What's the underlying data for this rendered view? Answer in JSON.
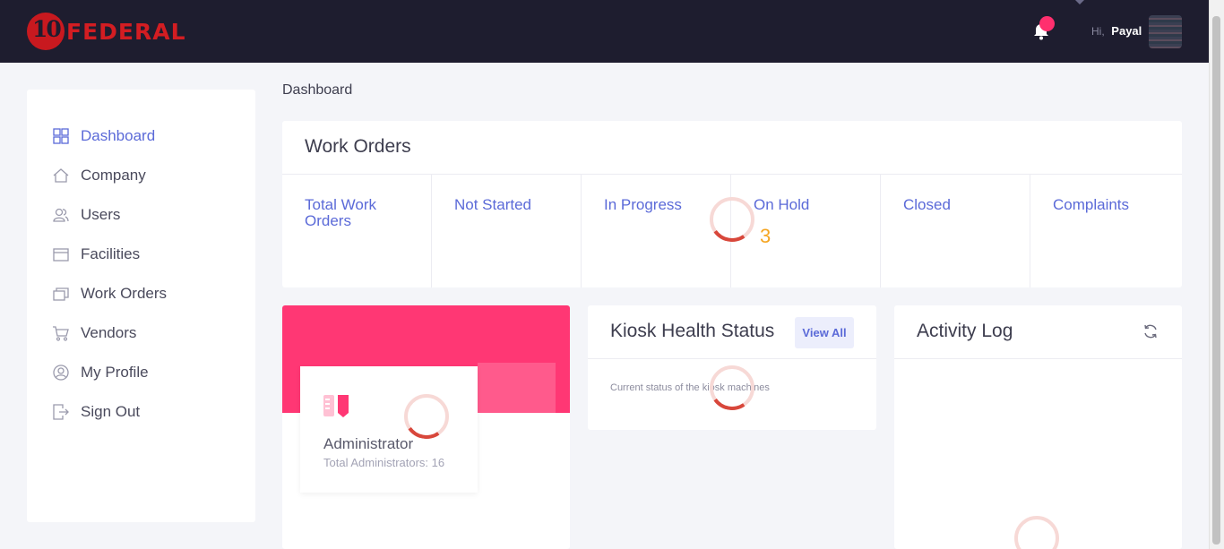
{
  "header": {
    "logo_number": "10",
    "logo_text": "FEDERAL",
    "greeting": "Hi,",
    "user_name": "Payal"
  },
  "sidebar": {
    "items": [
      {
        "label": "Dashboard",
        "icon": "dashboard-icon",
        "active": true
      },
      {
        "label": "Company",
        "icon": "home-icon",
        "active": false
      },
      {
        "label": "Users",
        "icon": "users-icon",
        "active": false
      },
      {
        "label": "Facilities",
        "icon": "facilities-icon",
        "active": false
      },
      {
        "label": "Work Orders",
        "icon": "work-orders-icon",
        "active": false
      },
      {
        "label": "Vendors",
        "icon": "cart-icon",
        "active": false
      },
      {
        "label": "My Profile",
        "icon": "profile-icon",
        "active": false
      },
      {
        "label": "Sign Out",
        "icon": "sign-out-icon",
        "active": false
      }
    ]
  },
  "breadcrumb": "Dashboard",
  "work_orders": {
    "title": "Work Orders",
    "columns": [
      {
        "label": "Total Work Orders",
        "value": ""
      },
      {
        "label": "Not Started",
        "value": ""
      },
      {
        "label": "In Progress",
        "value": ""
      },
      {
        "label": "On Hold",
        "value": "3"
      },
      {
        "label": "Closed",
        "value": ""
      },
      {
        "label": "Complaints",
        "value": ""
      }
    ]
  },
  "admin": {
    "title": "Administrator",
    "subtitle": "Total Administrators: 16"
  },
  "kiosk": {
    "title": "Kiosk Health Status",
    "view_all": "View All",
    "subtitle": "Current status of the kiosk machines"
  },
  "activity": {
    "title": "Activity Log"
  },
  "colors": {
    "header_bg": "#1e1d2f",
    "brand_red": "#d31d22",
    "accent": "#5b6ad8",
    "pink": "#ff3774",
    "value_orange": "#f5a623",
    "notification": "#ff2f6e"
  }
}
